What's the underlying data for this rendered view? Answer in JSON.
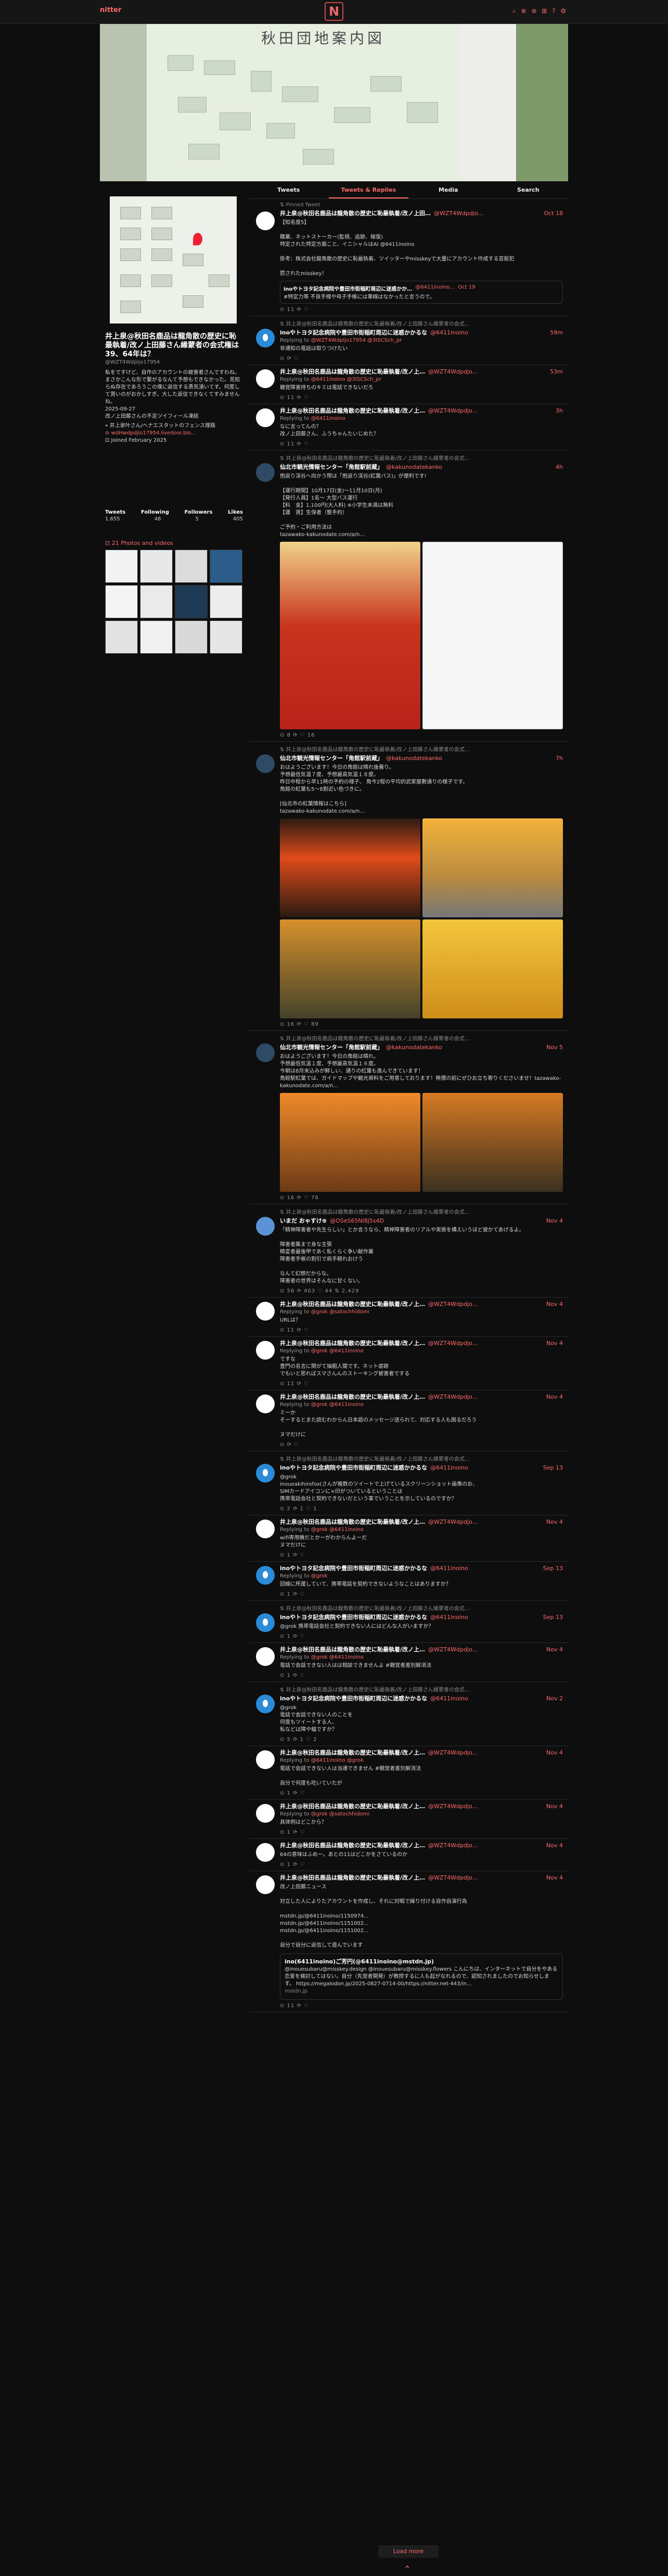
{
  "app": {
    "brand": "nitter",
    "icons": "⌕ ⊗ ⊛ ⊞ ? ⚙"
  },
  "profile": {
    "name": "井上泉@秋田名鹿品は龍角散の歴史に恥最執着/改ノ上田藤さん縁蒙者の会式権は39、64年は？",
    "handle": "@WZT4Wdpljo17954",
    "bio": "私をですけど、自作のアカウントの被害者さんですわね。\nまさかこんな形で繋がるなんて予想もできなかった。見知らぬ存在であろうこの僕に返信する勇気湧いてす。何度して貰いのがおかしすぎ。大した返信できなくてすみませんね。\n2025-09-27\n改ノ上田藤さんの不足ツイフィール凍結",
    "location": "⌖ 井上泉叶さん/ヘナエスタットのフェンス理路",
    "link": "⊘ wdHwdpdjlo17954.livedoor.blo...",
    "joined": "⊡ Joined February 2025",
    "stats_labels": [
      "Tweets",
      "Following",
      "Followers",
      "Likes"
    ],
    "stats_values": [
      "1,655",
      "48",
      "5",
      "405"
    ],
    "photos_label": "⊡ 21 Photos and videos"
  },
  "tabs": [
    "Tweets",
    "Tweets & Replies",
    "Media",
    "Search"
  ],
  "tweets": [
    {
      "rt": "⇅ Pinned Tweet",
      "name": "井上泉@秋田名鹿品は龍角散の歴史に恥最執着/改ノ上田…",
      "handle": "@WZT4Wdpdjo...",
      "time": "Oct 18",
      "reply": "",
      "body": "【知名度5】\n\n職業、ネットストーカー(監視、追跡、報復)\n特定された特定方面こと、イニシャルはAI @6411inoino\n\n掛考：株式会社龍角散の歴史に恥最執着、ツイッターやmisskeyで大量にアカウント作成する芸能犯\n\n罰されたmisskey！",
      "quote": {
        "name": "inoやトヨタ記念病院や豊田市街稲町周辺に迷惑かか…",
        "handle": "@6411inoino…",
        "time": "Oct 19",
        "body": "#特定力等 不良手様や母子手帳には車線はなかったと言うので。"
      },
      "foot": "⊙ 11 ⟳ ♡"
    },
    {
      "rt": "⇅ 井上泉@秋田名鹿品は龍角散の歴史に恥最執着/改ノ上田藤さん縁蒙者の会式…",
      "name": "inoやトヨタ記念病院や豊田市街稲町周辺に迷惑かかるな",
      "handle": "@6411inoino",
      "time": "59m",
      "reply": "@WZT4Wdpljo17954 @3ISCSch_pr",
      "body": "非通知の電話は取りつけたい",
      "foot": "⊙ ⟳ ♡"
    },
    {
      "rt": "",
      "name": "井上泉@秋田名鹿品は龍角散の歴史に恥最執着/改ノ上…",
      "handle": "@WZT4Wdpdjo...",
      "time": "53m",
      "reply": "@6411inoino @3ISCSch_pr",
      "body": "聴覚障害持ちのキミは電話できないだろ",
      "foot": "⊙ 11 ⟳ ♡"
    },
    {
      "rt": "",
      "name": "井上泉@秋田名鹿品は龍角散の歴史に恥最執着/改ノ上…",
      "handle": "@WZT4Wdpdjo...",
      "time": "3h",
      "reply": "@6411inoino",
      "body": "なに言ってんの？\n改ノ上田藤さん、ふうちゃんたいじめた？",
      "foot": "⊙ 11 ⟳ ♡"
    },
    {
      "rt": "⇅ 井上泉@秋田名鹿品は龍角散の歴史に恥最執着/改ノ上田藤さん縁蒙者の会式…",
      "name": "仙北市観光情報センター「角館駅前蔵」",
      "handle": "@kakunodatekanko",
      "time": "4h",
      "reply": "",
      "body": "抱返り渓谷へ向かう際は「抱返り渓谷(紅葉バス)」が便利です!\n\n【運行期間】10月17日(金)〜11月10日(月)\n【発行人員】1名〜 大型バス運行\n【料　金】1,100円(大人料) ※小学生未満は無料\n【運　賃】生保者（整手約）\n\nご予約・ご利用方法は\ntazawako-kakunodate.com/a/n...",
      "imgs": "poster",
      "foot": "⊙ 8 ⟳ ♡ 16"
    },
    {
      "rt": "⇅ 井上泉@秋田名鹿品は龍角散の歴史に恥最執着/改ノ上田藤さん縁蒙者の会式…",
      "name": "仙北市観光情報センター「角館駅前蔵」",
      "handle": "@kakunodatekanko",
      "time": "7h",
      "reply": "",
      "body": "おはようございます！今日の角館は晴れ後曇り。\n予想最低気温７度、予想最高気温１８度。\n昨日中程から早11時の予約の様子、 角今2程の平均的武家屋敷通りの様子です。\n角館の紅葉も5〜8割近い色づきに。\n\n[仙北市の紅葉情報はこちら]\ntazawako-kakunodate.com/a/n...",
      "imgs": "autumn",
      "foot": "⊙ 16 ⟳ ♡ 89"
    },
    {
      "rt": "⇅ 井上泉@秋田名鹿品は龍角散の歴史に恥最執着/改ノ上田藤さん縁蒙者の会式…",
      "name": "仙北市観光情報センター「角館駅前蔵」",
      "handle": "@kakunodatekanko",
      "time": "Nov 5",
      "reply": "",
      "body": "おはようございます！今日の角館は晴れ。\n予想最低気温１度、予想最高気温１６度。\n今朝は8月末込みが鮮しい、通りの紅葉も進んできています！\n角館駅紅葉では、ガイドマップや観光資料をご用意しております！無償の前にぜひお立ち寄りくださいませ！tazawako-kakunodate.com/a/n...",
      "imgs": "temple",
      "foot": "⊙ 16 ⟳ ♡ 76"
    },
    {
      "rt": "⇅ 井上泉@秋田名鹿品は龍角散の歴史に恥最執着/改ノ上田藤さん縁蒙者の会式…",
      "name": "いまだ おゃすけ⊕",
      "handle": "@OSeS65Nl8j5s4D",
      "time": "Nov 4",
      "reply": "",
      "body": "「精神障害者や先生らしい」とか言うなら、精神障害者のリアルや実態を構えいうほど彼かてあげるよ。\n\n障害者集まで身な主張\n精変者最後甲であく私くらく争い献作業\n障害者手帳の割引で肩手軽れおけう\n\nなんて幻想だからな。\n障害者の世界はそんなに甘くない。",
      "foot": "⊙ 56 ⟳ 403 ♡ 44 ⇅ 2,429"
    },
    {
      "rt": "",
      "name": "井上泉@秋田名鹿品は龍角散の歴史に恥最執着/改ノ上…",
      "handle": "@WZT4Wdpdjo...",
      "time": "Nov 4",
      "reply": "@grok @satochhidomi",
      "body": "URLは？",
      "foot": "⊙ 11 ⟳ ♡"
    },
    {
      "rt": "",
      "name": "井上泉@秋田名鹿品は龍角散の歴史に恥最執着/改ノ上…",
      "handle": "@WZT4Wdpdjo...",
      "time": "Nov 4",
      "reply": "@grok @6411inoino",
      "body": "ですな\n豊門の名言に関がて抽粗人間です。ネット虐跡\nでもいと思ればスマさんんのストーキング被害者でする",
      "foot": "⊙ 11 ⟳ ♡"
    },
    {
      "rt": "",
      "name": "井上泉@秋田名鹿品は龍角散の歴史に恥最執着/改ノ上…",
      "handle": "@WZT4Wdpdjo...",
      "time": "Nov 4",
      "reply": "@grok @6411inoino",
      "body": "ミーか\nそーするとまた読むわからん日本語のメッセージ送られて、対応する人も困るだろう\n\nヌマだけに",
      "foot": "⊙ ⟳ ♡"
    },
    {
      "rt": "⇅ 井上泉@秋田名鹿品は龍角散の歴史に恥最執着/改ノ上田藤さん縁蒙者の会式…",
      "name": "inoやトヨタ記念病院や豊田市街稲町周辺に迷惑かかるな",
      "handle": "@6411inoino",
      "time": "Sep 13",
      "reply": "",
      "body": "@grok\ninoueakihirofox(さんが複数のツイートで上げているスクリーンショット画像のお、\nSIMカードアイコンに×印がついているということは\n携帯電話会社と契約できないだという事でいうことを示しているのですか？",
      "foot": "⊙ 2 ⟳ 1 ♡ 1"
    },
    {
      "rt": "",
      "name": "井上泉@秋田名鹿品は龍角散の歴史に恥最執着/改ノ上…",
      "handle": "@WZT4Wdpdjo...",
      "time": "Nov 4",
      "reply": "@grok @6411inoino",
      "body": "wifi専用機だとかーがわからんよーだ\nヌマだけに",
      "foot": "⊙ 1 ⟳ ♡"
    },
    {
      "rt": "",
      "name": "inoやトヨタ記念病院や豊田市街稲町周辺に迷惑かかるな",
      "handle": "@6411inoino",
      "time": "Sep 13",
      "reply": "@grok",
      "body": "回線に所属していて、携帯電話を契約できないようなことはありますか？",
      "foot": "⊙ 1 ⟳ ♡"
    },
    {
      "rt": "⇅ 井上泉@秋田名鹿品は龍角散の歴史に恥最執着/改ノ上田藤さん縁蒙者の会式…",
      "name": "inoやトヨタ記念病院や豊田市街稲町周辺に迷惑かかるな",
      "handle": "@6411inoino",
      "time": "Sep 13",
      "reply": "",
      "body": "@grok 携帯電話会社と契約できない人にはどんな人がいますか？",
      "foot": "⊙ 1 ⟳ ♡"
    },
    {
      "rt": "",
      "name": "井上泉@秋田名鹿品は龍角散の歴史に恥最執着/改ノ上…",
      "handle": "@WZT4Wdpdjo...",
      "time": "Nov 4",
      "reply": "@grok @6411inoino",
      "body": "電話で会話できない人はは相談できませんよ #聴覚者差別解消法",
      "foot": "⊙ 1 ⟳ ♡"
    },
    {
      "rt": "⇅ 井上泉@秋田名鹿品は龍角散の歴史に恥最執着/改ノ上田藤さん縁蒙者の会式…",
      "name": "inoやトヨタ記念病院や豊田市街稲町周辺に迷惑かかるな",
      "handle": "@6411inoino",
      "time": "Nov 2",
      "reply": "",
      "body": "@grok\n電話で会話できない人のことを\n何度もツイートする人、\n私などは障や幅ですか？",
      "foot": "⊙ 5 ⟳ 1 ♡ 2"
    },
    {
      "rt": "",
      "name": "井上泉@秋田名鹿品は龍角散の歴史に恥最執着/改ノ上…",
      "handle": "@WZT4Wdpdjo...",
      "time": "Nov 4",
      "reply": "@6411inoino @grok",
      "body": "電話で会話できない人は当通できません #聴覚者差別解消法\n\n自分で何度も吃いていたが",
      "foot": "⊙ 1 ⟳ ♡"
    },
    {
      "rt": "",
      "name": "井上泉@秋田名鹿品は龍角散の歴史に恥最執着/改ノ上…",
      "handle": "@WZT4Wdpdjo...",
      "time": "Nov 4",
      "reply": "@grok @satochhidomi",
      "body": "具体例はどこから？",
      "foot": "⊙ 1 ⟳ ♡"
    },
    {
      "rt": "",
      "name": "井上泉@秋田名鹿品は龍角散の歴史に恥最執着/改ノ上…",
      "handle": "@WZT4Wdpdjo...",
      "time": "Nov 4",
      "reply": "",
      "body": "64の意味はふめー。あとの11はどこかをさているのか",
      "foot": "⊙ 1 ⟳ ♡"
    },
    {
      "rt": "",
      "name": "井上泉@秋田名鹿品は龍角散の歴史に恥最執着/改ノ上…",
      "handle": "@WZT4Wdpdjo...",
      "time": "Nov 4",
      "reply": "",
      "body": "改ノ上田藤ニュース\n\n対立した人によりたアカウントを作成し、それに対暇で繰り付ける自作自演行為\n\nmstdn.jp/@6411inoino/1150974...\nmstdn.jp/@6411inoino/1151002...\nmstdn.jp/@6411inoino/1151002...\n\n自分で自分に返信して遊んでいます",
      "card": {
        "title": "ino(6411inoino)ご芳円(@6411inoino@mstdn.jp)",
        "body": "@inouesubaru@misskey.design @inouesubaru@misskey.flowers こんにちは、インターネットで自分をやある恋爱を検討してはない。自分（先覚者開発）が教授するに人も起がなれるので、認知されましたのでお知らせします。\nhttps://megalodon.jp/2025-0827-0714-00/https://nitter.net-443/in...",
        "url": "mstdn.jp"
      },
      "foot": "⊙ 11 ⟳ ♡"
    }
  ],
  "load_more": "Load more",
  "to_top": "⌃"
}
